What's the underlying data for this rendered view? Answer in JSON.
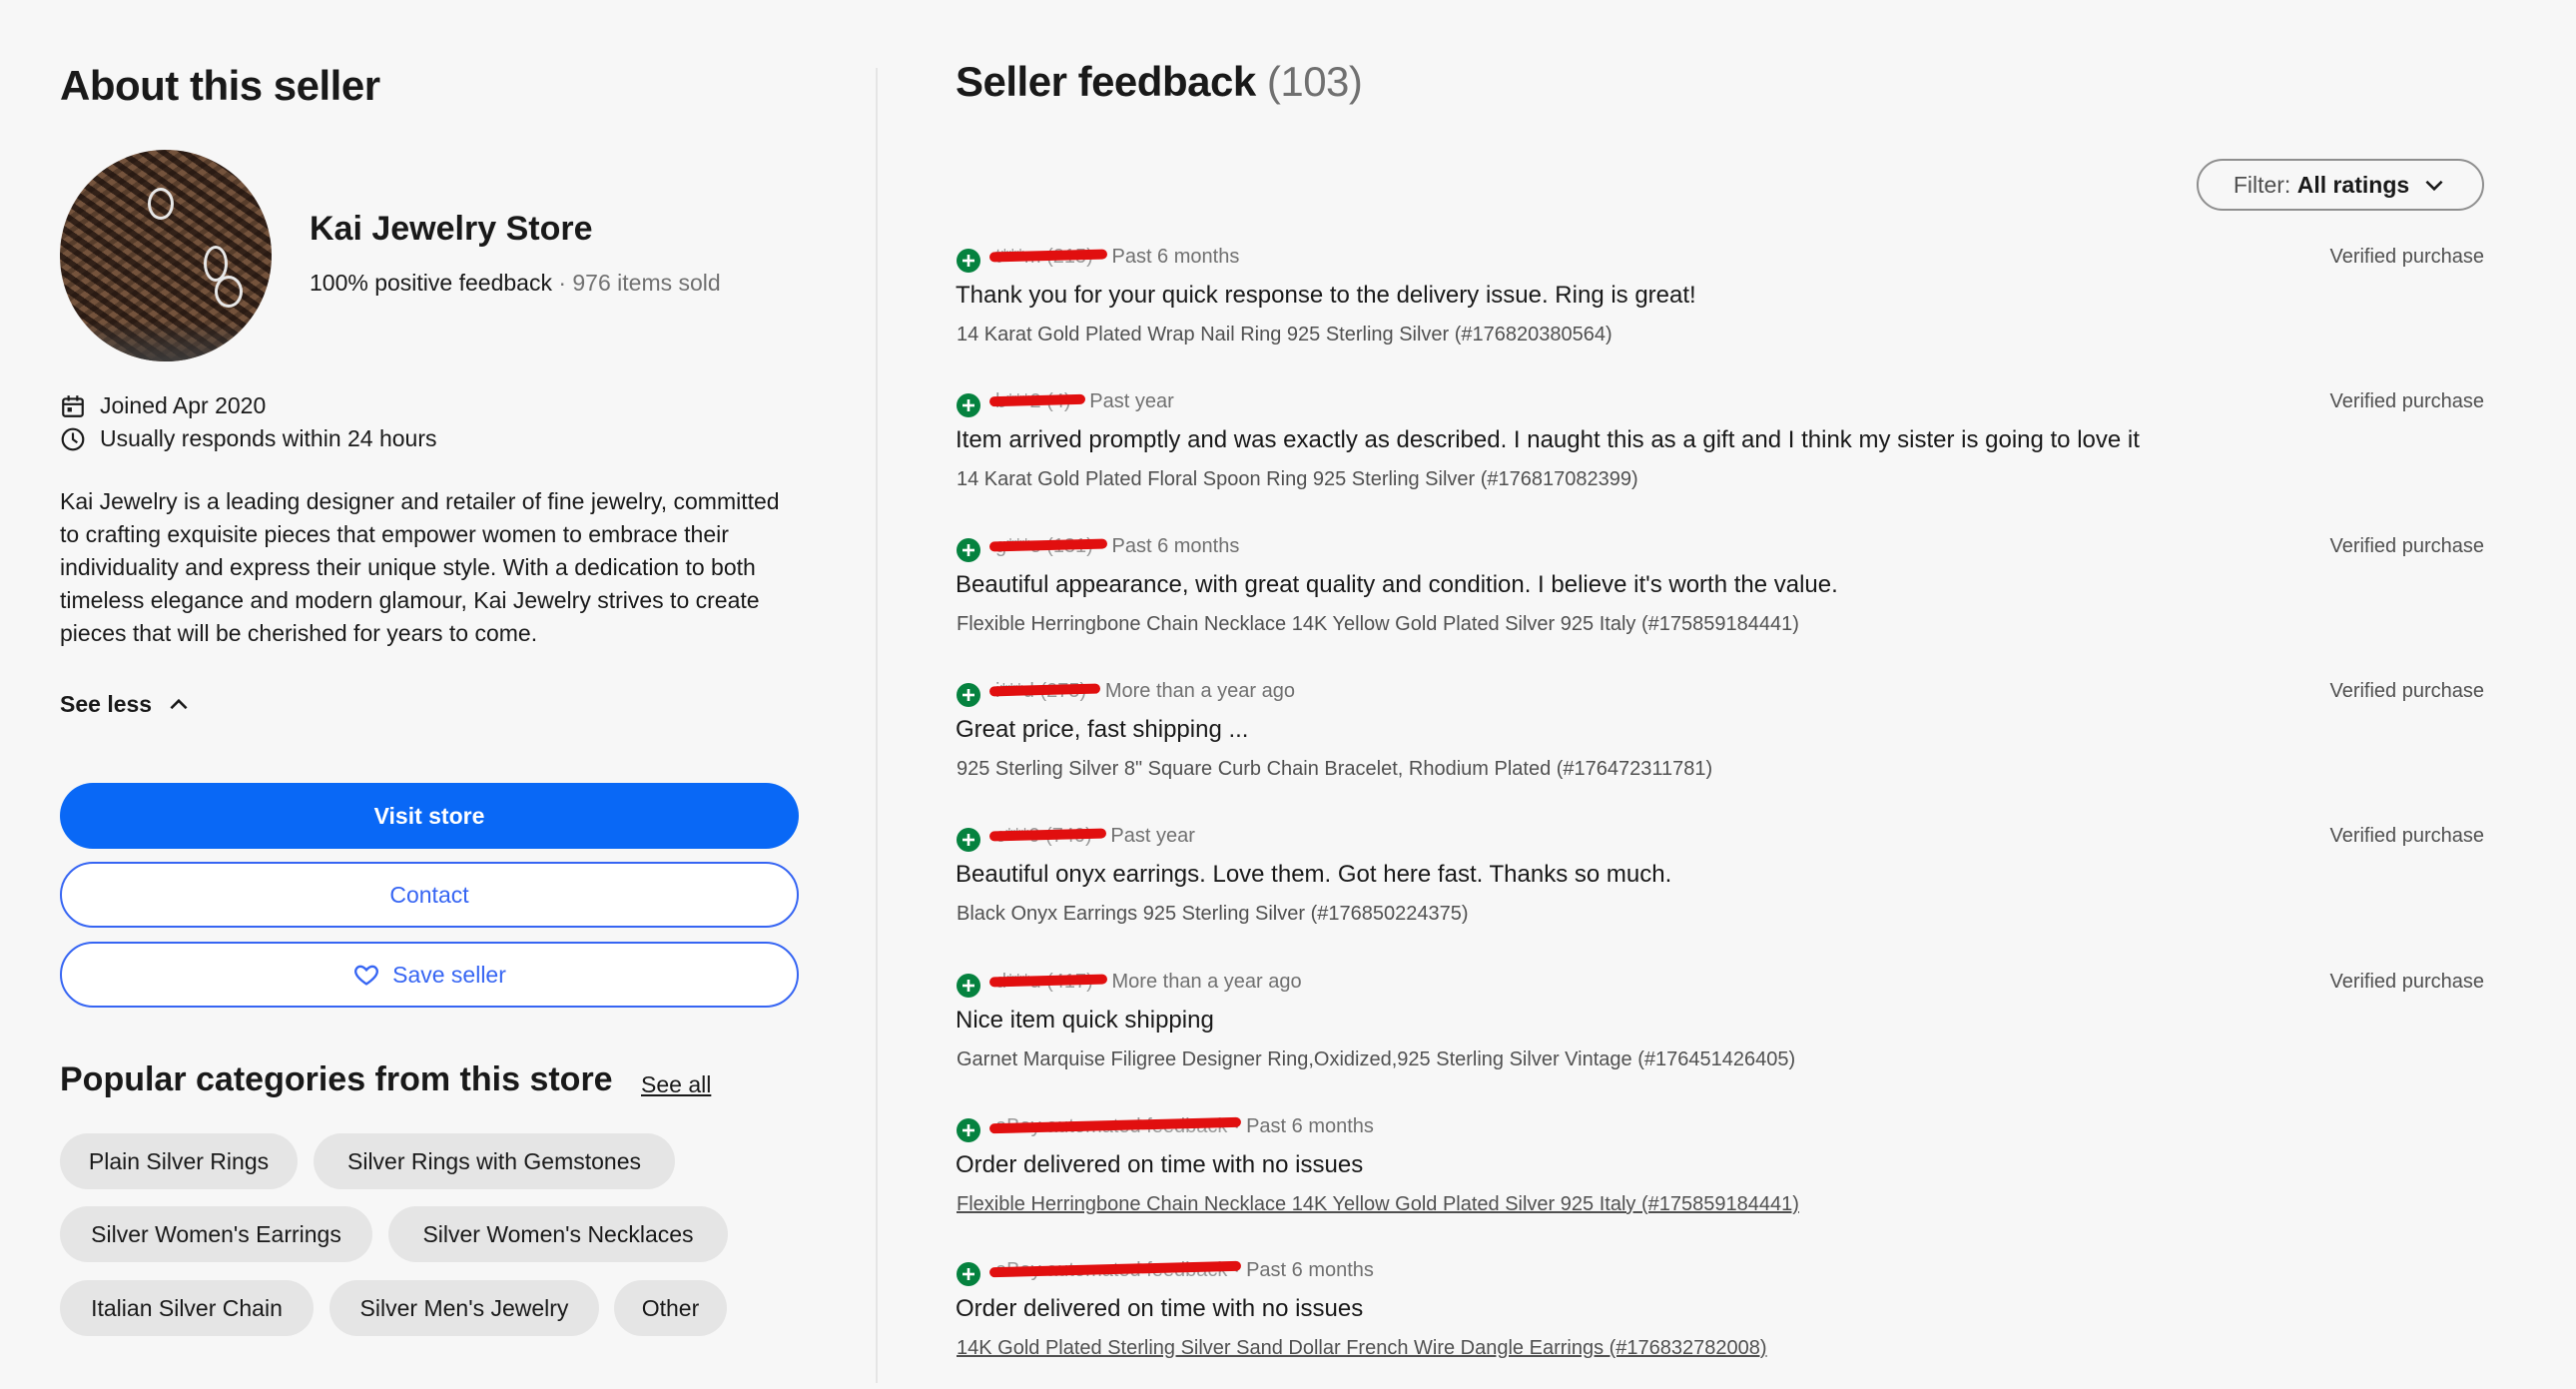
{
  "about": {
    "heading": "About this seller",
    "store_name": "Kai Jewelry Store",
    "positive_feedback": "100% positive feedback",
    "items_sold": "976 items sold",
    "joined": "Joined Apr 2020",
    "response_time": "Usually responds within 24 hours",
    "description": "Kai Jewelry is a leading designer and retailer of fine jewelry, committed to crafting exquisite pieces that empower women to embrace their individuality and express their unique style. With a dedication to both timeless elegance and modern glamour, Kai Jewelry strives to create pieces that will be cherished for years to come.",
    "see_less": "See less",
    "visit_store": "Visit store",
    "contact": "Contact",
    "save_seller": "Save seller"
  },
  "categories": {
    "heading": "Popular categories from this store",
    "see_all": "See all",
    "items": [
      "Plain Silver Rings",
      "Silver Rings with Gemstones",
      "Silver Women's Earrings",
      "Silver Women's Necklaces",
      "Italian Silver Chain",
      "Silver Men's Jewelry",
      "Other"
    ]
  },
  "feedback": {
    "heading": "Seller feedback",
    "count": "(103)",
    "filter_label": "Filter:",
    "filter_value": "All ratings",
    "reviews": [
      {
        "user": "t***m (215)",
        "time": "Past 6 months",
        "verified": "Verified purchase",
        "comment": "Thank you for your quick response to the delivery issue. Ring is great!",
        "item": "14 Karat Gold Plated Wrap Nail Ring 925 Sterling Silver (#176820380564)"
      },
      {
        "user": "b***2 (4)",
        "time": "Past year",
        "verified": "Verified purchase",
        "comment": "Item arrived promptly and was exactly as described. I naught this as a gift and I think my sister is going to love it",
        "item": "14 Karat Gold Plated Floral Spoon Ring 925 Sterling Silver (#176817082399)"
      },
      {
        "user": "g***e (131)",
        "time": "Past 6 months",
        "verified": "Verified purchase",
        "comment": "Beautiful appearance, with great quality and condition. I believe it's worth the value.",
        "item": "Flexible Herringbone Chain Necklace 14K Yellow Gold Plated Silver 925 Italy (#175859184441)"
      },
      {
        "user": "i***d (275)",
        "time": "More than a year ago",
        "verified": "Verified purchase",
        "comment": "Great price, fast shipping ...",
        "item": "925 Sterling Silver 8\" Square Curb Chain Bracelet, Rhodium Plated (#176472311781)"
      },
      {
        "user": "c***0 (740)",
        "time": "Past year",
        "verified": "Verified purchase",
        "comment": "Beautiful onyx earrings. Love them. Got here fast. Thanks so much.",
        "item": "Black Onyx Earrings 925 Sterling Silver (#176850224375)"
      },
      {
        "user": "d***u (417)",
        "time": "More than a year ago",
        "verified": "Verified purchase",
        "comment": "Nice item quick shipping",
        "item": "Garnet Marquise Filigree Designer Ring,Oxidized,925 Sterling Silver Vintage (#176451426405)"
      },
      {
        "user": "eBay automated feedback",
        "time": "Past 6 months",
        "verified": "",
        "comment": "Order delivered on time with no issues",
        "item": "Flexible Herringbone Chain Necklace 14K Yellow Gold Plated Silver 925 Italy (#175859184441)"
      },
      {
        "user": "eBay automated feedback",
        "time": "Past 6 months",
        "verified": "",
        "comment": "Order delivered on time with no issues",
        "item": "14K Gold Plated Sterling Silver Sand Dollar French Wire Dangle Earrings (#176832782008)"
      }
    ]
  },
  "colors": {
    "primary": "#0968f6",
    "outline": "#3665f3",
    "positive": "#05823f",
    "redaction": "#e10f0f"
  }
}
